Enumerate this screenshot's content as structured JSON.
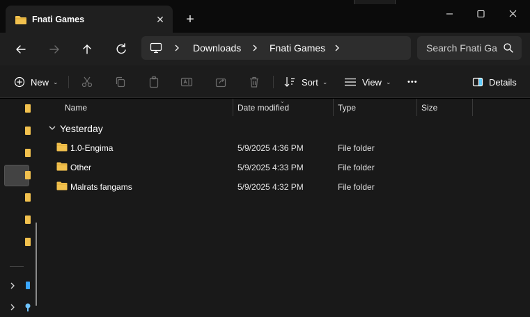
{
  "window": {
    "tab_title": "Fnati Games",
    "tab_icon": "folder-icon",
    "new_tab_glyph": "+",
    "close_tab_glyph": "✕"
  },
  "navigation": {
    "back": "arrow-left-icon",
    "forward": "arrow-right-icon",
    "up": "arrow-up-icon",
    "refresh": "refresh-icon"
  },
  "address": {
    "crumbs": [
      "Downloads",
      "Fnati Games"
    ],
    "separator": "›"
  },
  "search": {
    "placeholder": "Search Fnati Games"
  },
  "toolbar": {
    "new_label": "New",
    "sort_label": "Sort",
    "view_label": "View",
    "more_label": "•••",
    "details_label": "Details"
  },
  "columns": {
    "name": "Name",
    "date_modified": "Date modified",
    "type": "Type",
    "size": "Size"
  },
  "group": {
    "title": "Yesterday"
  },
  "files": [
    {
      "name": "1.0-Engima",
      "date": "5/9/2025 4:36 PM",
      "type": "File folder"
    },
    {
      "name": "Other",
      "date": "5/9/2025 4:33 PM",
      "type": "File folder"
    },
    {
      "name": "Malrats fangams",
      "date": "5/9/2025 4:32 PM",
      "type": "File folder"
    }
  ],
  "colors": {
    "folder": "#F2C14E",
    "background": "#191919",
    "toolbar": "#1c1c1c",
    "titlebar": "#0b0b0b",
    "accent": "#60CDFF"
  }
}
